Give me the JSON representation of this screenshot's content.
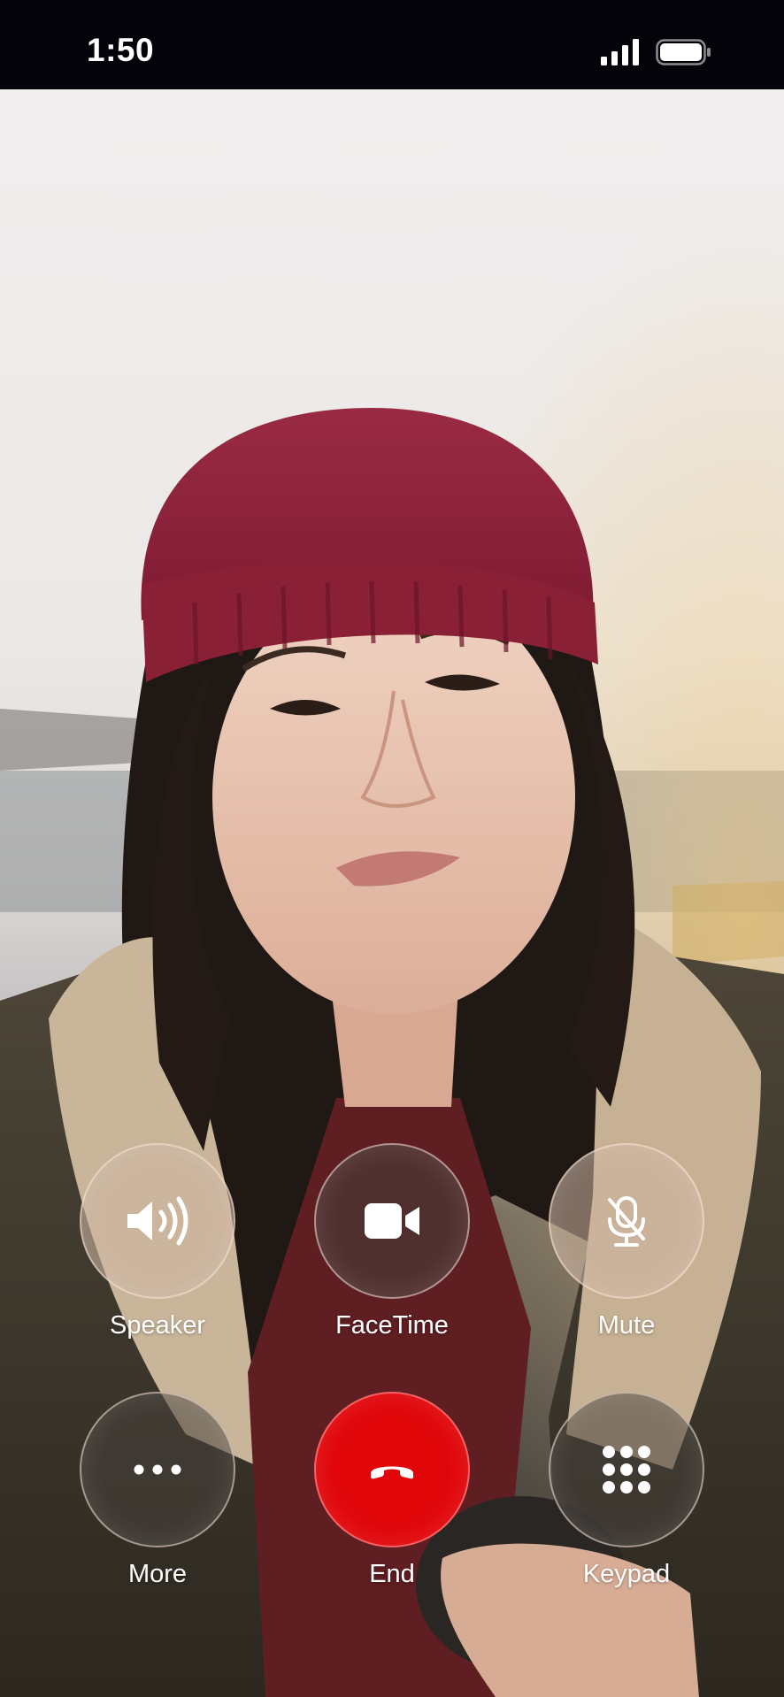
{
  "status_bar": {
    "time": "1:50",
    "signal_icon": "cellular-signal-icon",
    "battery_icon": "battery-icon"
  },
  "call": {
    "background_icon": "caller-video-feed"
  },
  "controls": {
    "speaker": {
      "label": "Speaker",
      "icon": "speaker-icon"
    },
    "facetime": {
      "label": "FaceTime",
      "icon": "video-camera-icon"
    },
    "mute": {
      "label": "Mute",
      "icon": "microphone-slash-icon"
    },
    "more": {
      "label": "More",
      "icon": "ellipsis-icon"
    },
    "end": {
      "label": "End",
      "icon": "end-call-icon",
      "color": "#e0060a"
    },
    "keypad": {
      "label": "Keypad",
      "icon": "keypad-icon"
    }
  }
}
